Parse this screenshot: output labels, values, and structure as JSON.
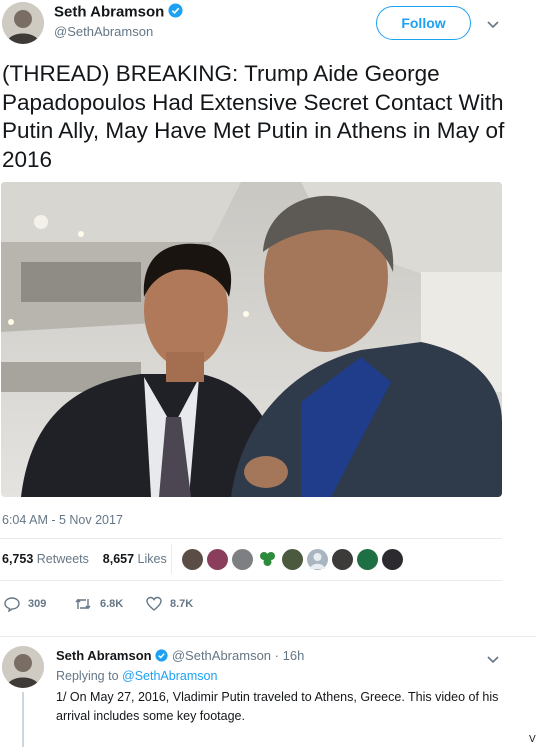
{
  "tweet": {
    "author_name": "Seth Abramson",
    "author_handle": "@SethAbramson",
    "follow_label": "Follow",
    "text": "(THREAD) BREAKING: Trump Aide George Papadopoulos Had Extensive Secret Contact With Putin Ally, May Have Met Putin in Athens in May of 2016",
    "timestamp": "6:04 AM - 5 Nov 2017",
    "retweets_count": "6,753",
    "retweets_label": "Retweets",
    "likes_count": "8,657",
    "likes_label": "Likes",
    "reply_count": "309",
    "retweet_action_count": "6.8K",
    "like_action_count": "8.7K"
  },
  "reply": {
    "author_name": "Seth Abramson",
    "author_handle": "@SethAbramson",
    "time": "· 16h",
    "replying_prefix": "Replying to",
    "replying_handle": "@SethAbramson",
    "text": "1/ On May 27, 2016, Vladimir Putin traveled to Athens, Greece. This video of his arrival includes some key footage."
  },
  "edge_char": "V",
  "colors": {
    "accent": "#1da1f2",
    "muted": "#657786",
    "text": "#14171a",
    "divider": "#e6ecf0"
  }
}
